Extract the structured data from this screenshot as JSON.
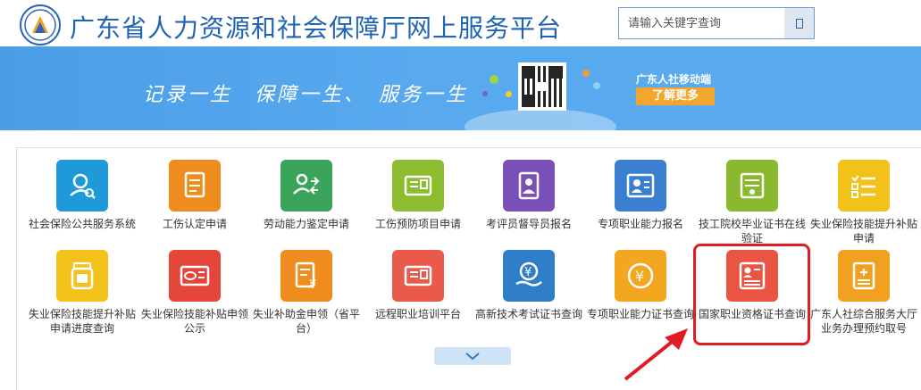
{
  "header": {
    "title": "广东省人力资源和社会保障厅网上服务平台",
    "search": {
      "placeholder": "请输入关键字查询",
      "button_icon": "search-icon"
    }
  },
  "banner": {
    "slogan": "记录一生　保障一生、　服务一生",
    "mobile_title": "广东人社移动端",
    "learn_more": "了解更多"
  },
  "services": [
    {
      "label": "社会保险公共服务系统",
      "color": "#1f9ad8",
      "icon": "user-search-icon"
    },
    {
      "label": "工伤认定申请",
      "color": "#ef8c1e",
      "icon": "document-icon"
    },
    {
      "label": "劳动能力鉴定申请",
      "color": "#3aa55a",
      "icon": "users-transfer-icon"
    },
    {
      "label": "工伤预防项目申请",
      "color": "#8bbd2e",
      "icon": "id-card-icon"
    },
    {
      "label": "考评员督导员报名",
      "color": "#7a4fb8",
      "icon": "person-document-icon"
    },
    {
      "label": "专项职业能力报名",
      "color": "#3a7fd0",
      "icon": "id-badge-icon"
    },
    {
      "label": "技工院校毕业证书在线验证",
      "color": "#89b92c",
      "icon": "certificate-icon"
    },
    {
      "label": "失业保险技能提升补贴申请",
      "color": "#f2c21b",
      "icon": "checklist-icon"
    },
    {
      "label": "失业保险技能提升补贴申请进度查询",
      "color": "#f2c21b",
      "icon": "medicine-bottle-icon"
    },
    {
      "label": "失业保险技能补贴申领公示",
      "color": "#e4463a",
      "icon": "si-card-icon"
    },
    {
      "label": "失业补助金申领（省平台）",
      "color": "#ef8c1e",
      "icon": "yuan-document-icon"
    },
    {
      "label": "远程职业培训平台",
      "color": "#ea5a4a",
      "icon": "id-card-icon"
    },
    {
      "label": "高新技术考试证书查询",
      "color": "#2e7fc7",
      "icon": "yuan-hand-icon"
    },
    {
      "label": "专项职业能力证书查询",
      "color": "#f3a61f",
      "icon": "yuan-coin-icon"
    },
    {
      "label": "国家职业资格证书查询",
      "color": "#ea5443",
      "icon": "person-list-icon"
    },
    {
      "label": "广东人社综合服务大厅业务办理预约取号",
      "color": "#f1a11f",
      "icon": "document-plus-icon"
    }
  ],
  "highlight_color": "#e11b24"
}
